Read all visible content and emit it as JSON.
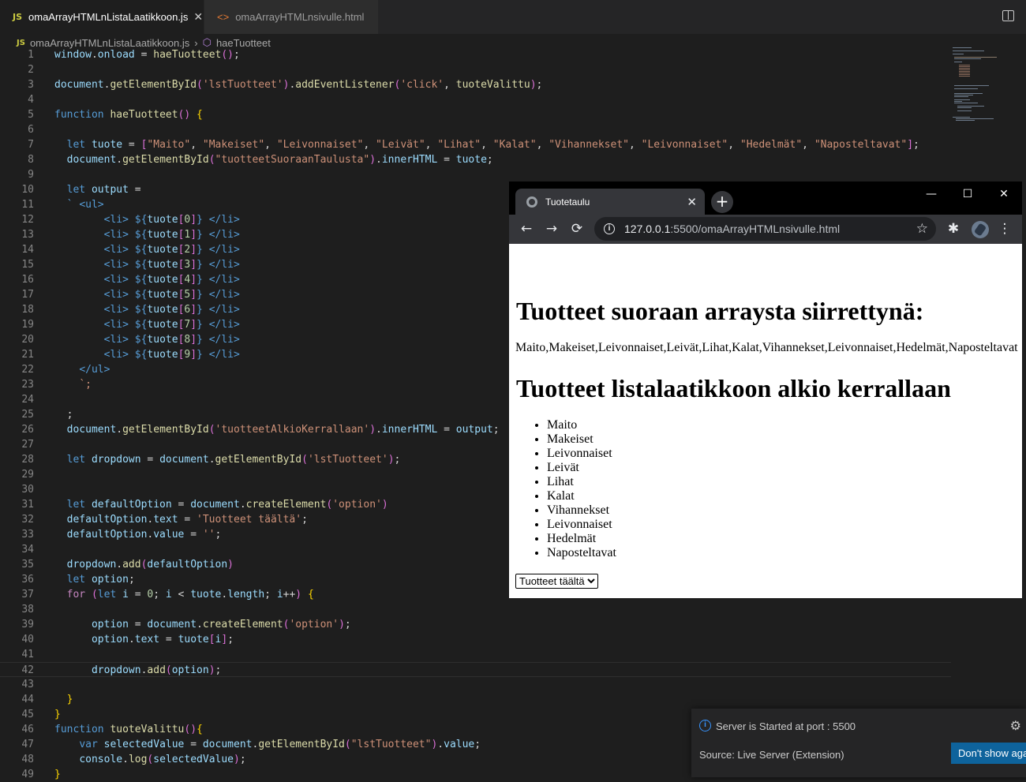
{
  "editor": {
    "tabs": [
      {
        "label": "omaArrayHTMLnListaLaatikkoon.js",
        "badge": "JS",
        "active": true
      },
      {
        "label": "omaArrayHTMLnsivulle.html",
        "badge": "<>",
        "active": false
      }
    ],
    "breadcrumb": {
      "file": "omaArrayHTMLnListaLaatikkoon.js",
      "symbol": "haeTuotteet"
    },
    "code_lines": [
      "window.onload = haeTuotteet();",
      "",
      "document.getElementById('lstTuotteet').addEventListener('click', tuoteValittu);",
      "",
      "function haeTuotteet() {",
      "",
      "  let tuote = [\"Maito\", \"Makeiset\", \"Leivonnaiset\", \"Leivät\", \"Lihat\", \"Kalat\", \"Vihannekset\", \"Leivonnaiset\", \"Hedelmät\", \"Naposteltavat\"];",
      "  document.getElementById(\"tuotteetSuoraanTaulusta\").innerHTML = tuote;",
      "",
      "  let output =",
      "  ` <ul>",
      "        <li> ${tuote[0]} </li>",
      "        <li> ${tuote[1]} </li>",
      "        <li> ${tuote[2]} </li>",
      "        <li> ${tuote[3]} </li>",
      "        <li> ${tuote[4]} </li>",
      "        <li> ${tuote[5]} </li>",
      "        <li> ${tuote[6]} </li>",
      "        <li> ${tuote[7]} </li>",
      "        <li> ${tuote[8]} </li>",
      "        <li> ${tuote[9]} </li>",
      "    </ul>",
      "    `;",
      "",
      "  ;",
      "  document.getElementById('tuotteetAlkioKerrallaan').innerHTML = output;",
      "",
      "  let dropdown = document.getElementById('lstTuotteet');",
      "",
      "",
      "  let defaultOption = document.createElement('option')",
      "  defaultOption.text = 'Tuotteet täältä';",
      "  defaultOption.value = '';",
      "",
      "  dropdown.add(defaultOption)",
      "  let option;",
      "  for (let i = 0; i < tuote.length; i++) {",
      "",
      "      option = document.createElement('option');",
      "      option.text = tuote[i];",
      "",
      "      dropdown.add(option);",
      "",
      "  }",
      "}",
      "function tuoteValittu(){",
      "    var selectedValue = document.getElementById(\"lstTuotteet\").value;",
      "    console.log(selectedValue);",
      "}"
    ]
  },
  "browser": {
    "tab_title": "Tuotetaulu",
    "url_host": "127.0.0.1",
    "url_rest": ":5500/omaArrayHTMLnsivulle.html",
    "page": {
      "heading1": "Tuotteet suoraan arraysta siirrettynä:",
      "plain_list": "Maito,Makeiset,Leivonnaiset,Leivät,Lihat,Kalat,Vihannekset,Leivonnaiset,Hedelmät,Naposteltavat",
      "heading2": "Tuotteet listalaatikkoon alkio kerrallaan",
      "items": [
        "Maito",
        "Makeiset",
        "Leivonnaiset",
        "Leivät",
        "Lihat",
        "Kalat",
        "Vihannekset",
        "Leivonnaiset",
        "Hedelmät",
        "Naposteltavat"
      ],
      "select_value": "Tuotteet täältä"
    }
  },
  "toast": {
    "message": "Server is Started at port : 5500",
    "source": "Source: Live Server (Extension)",
    "button": "Don't show again"
  }
}
